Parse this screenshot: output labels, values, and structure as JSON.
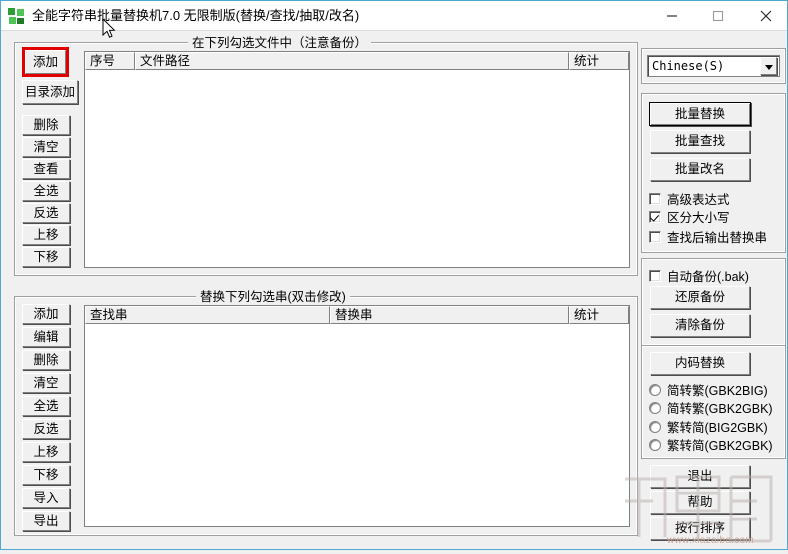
{
  "window": {
    "title": "全能字符串批量替换机7.0 无限制版(替换/查找/抽取/改名)",
    "icon": "app-squares-icon",
    "border_color": "#4fa8d0",
    "minimize_label": "—",
    "maximize_label": "□",
    "close_label": "✕"
  },
  "files_group": {
    "title": "在下列勾选文件中（注意备份）",
    "columns": [
      "序号",
      "文件路径",
      "统计"
    ],
    "rows": [],
    "buttons": [
      {
        "label": "添加",
        "highlighted": true
      },
      {
        "label": "目录添加",
        "highlighted": false
      },
      {
        "label": "删除",
        "highlighted": false
      },
      {
        "label": "清空",
        "highlighted": false
      },
      {
        "label": "查看",
        "highlighted": false
      },
      {
        "label": "全选",
        "highlighted": false
      },
      {
        "label": "反选",
        "highlighted": false
      },
      {
        "label": "上移",
        "highlighted": false
      },
      {
        "label": "下移",
        "highlighted": false
      }
    ]
  },
  "strings_group": {
    "title": "替换下列勾选串(双击修改)",
    "columns": [
      "查找串",
      "替换串",
      "统计"
    ],
    "rows": [],
    "buttons": [
      {
        "label": "添加"
      },
      {
        "label": "编辑"
      },
      {
        "label": "删除"
      },
      {
        "label": "清空"
      },
      {
        "label": "全选"
      },
      {
        "label": "反选"
      },
      {
        "label": "上移"
      },
      {
        "label": "下移"
      },
      {
        "label": "导入"
      },
      {
        "label": "导出"
      }
    ]
  },
  "right_panel": {
    "language": {
      "selected": "Chinese(S)",
      "options": [
        "Chinese(S)"
      ]
    },
    "actions": {
      "batch_replace": "批量替换",
      "batch_find": "批量查找",
      "batch_rename": "批量改名"
    },
    "options": [
      {
        "label": "高级表达式",
        "checked": false
      },
      {
        "label": "区分大小写",
        "checked": true
      },
      {
        "label": "查找后输出替换串",
        "checked": false
      }
    ],
    "backup": {
      "auto_backup": {
        "label": "自动备份(.bak)",
        "checked": false
      },
      "restore_label": "还原备份",
      "clear_label": "清除备份"
    },
    "encoding": {
      "convert_label": "内码替换",
      "radios": [
        {
          "label": "简转繁(GBK2BIG)",
          "selected": false
        },
        {
          "label": "简转繁(GBK2GBK)",
          "selected": false
        },
        {
          "label": "繁转简(BIG2GBK)",
          "selected": false
        },
        {
          "label": "繁转简(GBK2GBK)",
          "selected": false
        }
      ]
    },
    "footer": {
      "exit_label": "退出",
      "help_label": "帮助",
      "sort_label": "按行排序"
    }
  },
  "watermark": {
    "url": "www.xiazaiba.com"
  }
}
